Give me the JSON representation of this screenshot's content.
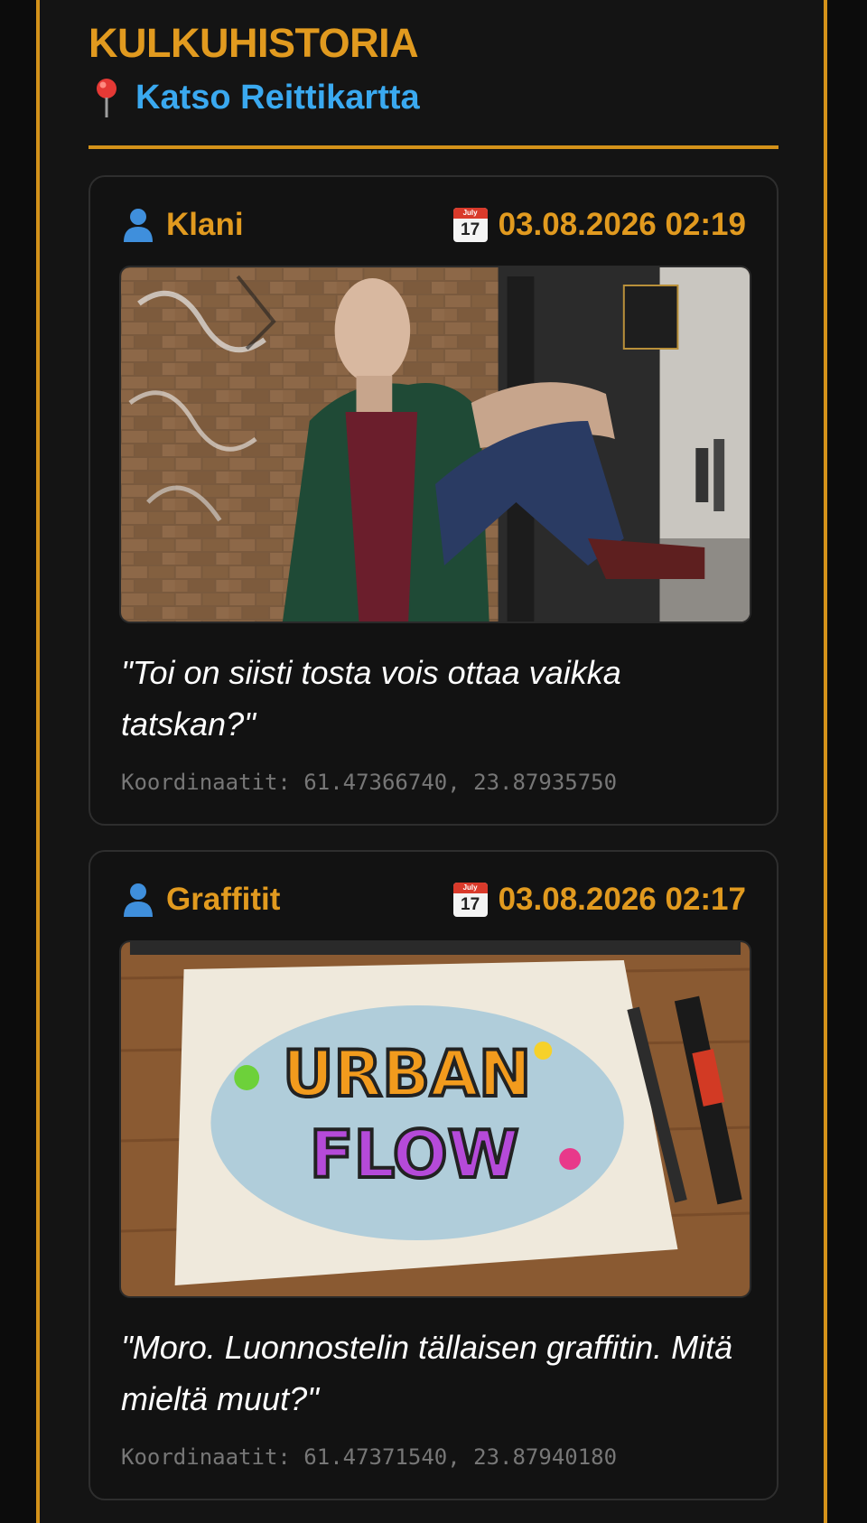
{
  "header": {
    "title": "KULKUHISTORIA",
    "map_link": "Katso Reittikartta",
    "map_icon": "pin-icon"
  },
  "colors": {
    "accent": "#d4921a",
    "title": "#e19a1f",
    "link": "#3aa9f0",
    "card_bg": "#121212",
    "muted": "#777777"
  },
  "entries": [
    {
      "user": "Klani",
      "date": "03.08.2026 02:19",
      "calendar_month": "July",
      "calendar_day": "17",
      "image_alt": "Photo of a tattooed man in green jacket and maroon polo sitting against a graffiti brick wall",
      "quote": "\"Toi on siisti tosta vois ottaa vaikka tatskan?\"",
      "coords_label": "Koordinaatit: 61.47366740, 23.87935750"
    },
    {
      "user": "Graffitit",
      "date": "03.08.2026 02:17",
      "calendar_month": "July",
      "calendar_day": "17",
      "image_alt": "Sketch of colorful graffiti lettering on paper on a wooden desk with markers",
      "image_text": "URBAN FLOW",
      "quote": "\"Moro. Luonnostelin tällaisen graffitin. Mitä mieltä muut?\"",
      "coords_label": "Koordinaatit: 61.47371540, 23.87940180"
    }
  ]
}
